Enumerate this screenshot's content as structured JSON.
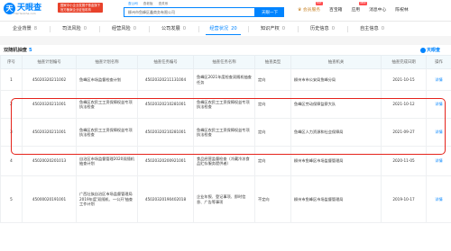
{
  "logo": {
    "text": "天眼查",
    "icon_char": "天",
    "subtitle": "TianYanCha.com"
  },
  "promo": {
    "line1": "国家中小企业发展子基金旗下",
    "line2": "官方备案企业征信机构"
  },
  "search": {
    "tabs": [
      "查公司",
      "查老板",
      "查关系"
    ],
    "value": "柳州市鱼峰区鑫商务有限公司",
    "button": "天眼一下"
  },
  "topnav": {
    "vip": "会员服务",
    "vip_badge": "HOT",
    "items": [
      "百宝箱",
      "应用",
      "消息中心",
      "陈祝林"
    ],
    "items_badge": "NEW"
  },
  "tabs": [
    {
      "label": "企业背景",
      "count": "8"
    },
    {
      "label": "司法风险",
      "count": "0"
    },
    {
      "label": "经营风险",
      "count": "0"
    },
    {
      "label": "公司发展",
      "count": "0"
    },
    {
      "label": "经营状况",
      "count": "20"
    },
    {
      "label": "知识产权",
      "count": "0"
    },
    {
      "label": "历史信息",
      "count": "0"
    },
    {
      "label": "自主信息",
      "count": "0"
    }
  ],
  "section": {
    "title": "双随机抽查",
    "count": "5",
    "watermark": "天眼查"
  },
  "table": {
    "headers": [
      "序号",
      "抽查计划编号",
      "抽查计划名称",
      "抽查任务编号",
      "抽查任务名称",
      "抽查类型",
      "抽查机关",
      "抽查完成日期",
      "操作"
    ],
    "rows": [
      [
        "1",
        "45020320211002",
        "鱼峰区市场监督检查计划",
        "45020320211131004",
        "鱼峰区2021年度检查双随机抽查任务",
        "定向",
        "柳州市市公安局鱼峰分局",
        "2021-10-15",
        "详情"
      ],
      [
        "2",
        "45020320211001",
        "鱼峰区农民工工资保障权益专项执法检查",
        "45020320210281001",
        "鱼峰区农民工工资保障权益专项执法检查",
        "定向",
        "鱼峰区劳动保障监察大队",
        "2021-10-12",
        "详情"
      ],
      [
        "3",
        "45020320211001",
        "鱼峰区农民工工资保障权益专项执法检查",
        "45020320210281001",
        "鱼峰区农民工工资保障权益专项执法检查",
        "定向",
        "鱼峰区人力资源和社会保障局",
        "2021-09-27",
        "详情"
      ],
      [
        "4",
        "45020020201013",
        "自治区市场监督管理2020双随机抽查计划",
        "45020320200921001",
        "食品经营监督检查（冷藏冷冻食品贮存服务提供者）",
        "定向",
        "柳州市鱼峰区市场监督管理局",
        "2020-11-05",
        "详情"
      ],
      [
        "5",
        "45000020191001",
        "广西壮族自治区市场监督管理局2019年度'双随机、一公开'抽查工作计划",
        "45020320190402018",
        "企业年报、登记事项、即时信息、广告等事项",
        "不定向",
        "柳州市鱼峰区市场监督管理局",
        "2019-10-17",
        "详情"
      ]
    ]
  },
  "colors": {
    "accent": "#0084ff",
    "highlight": "#e5231b",
    "promo": "#e8422b"
  }
}
